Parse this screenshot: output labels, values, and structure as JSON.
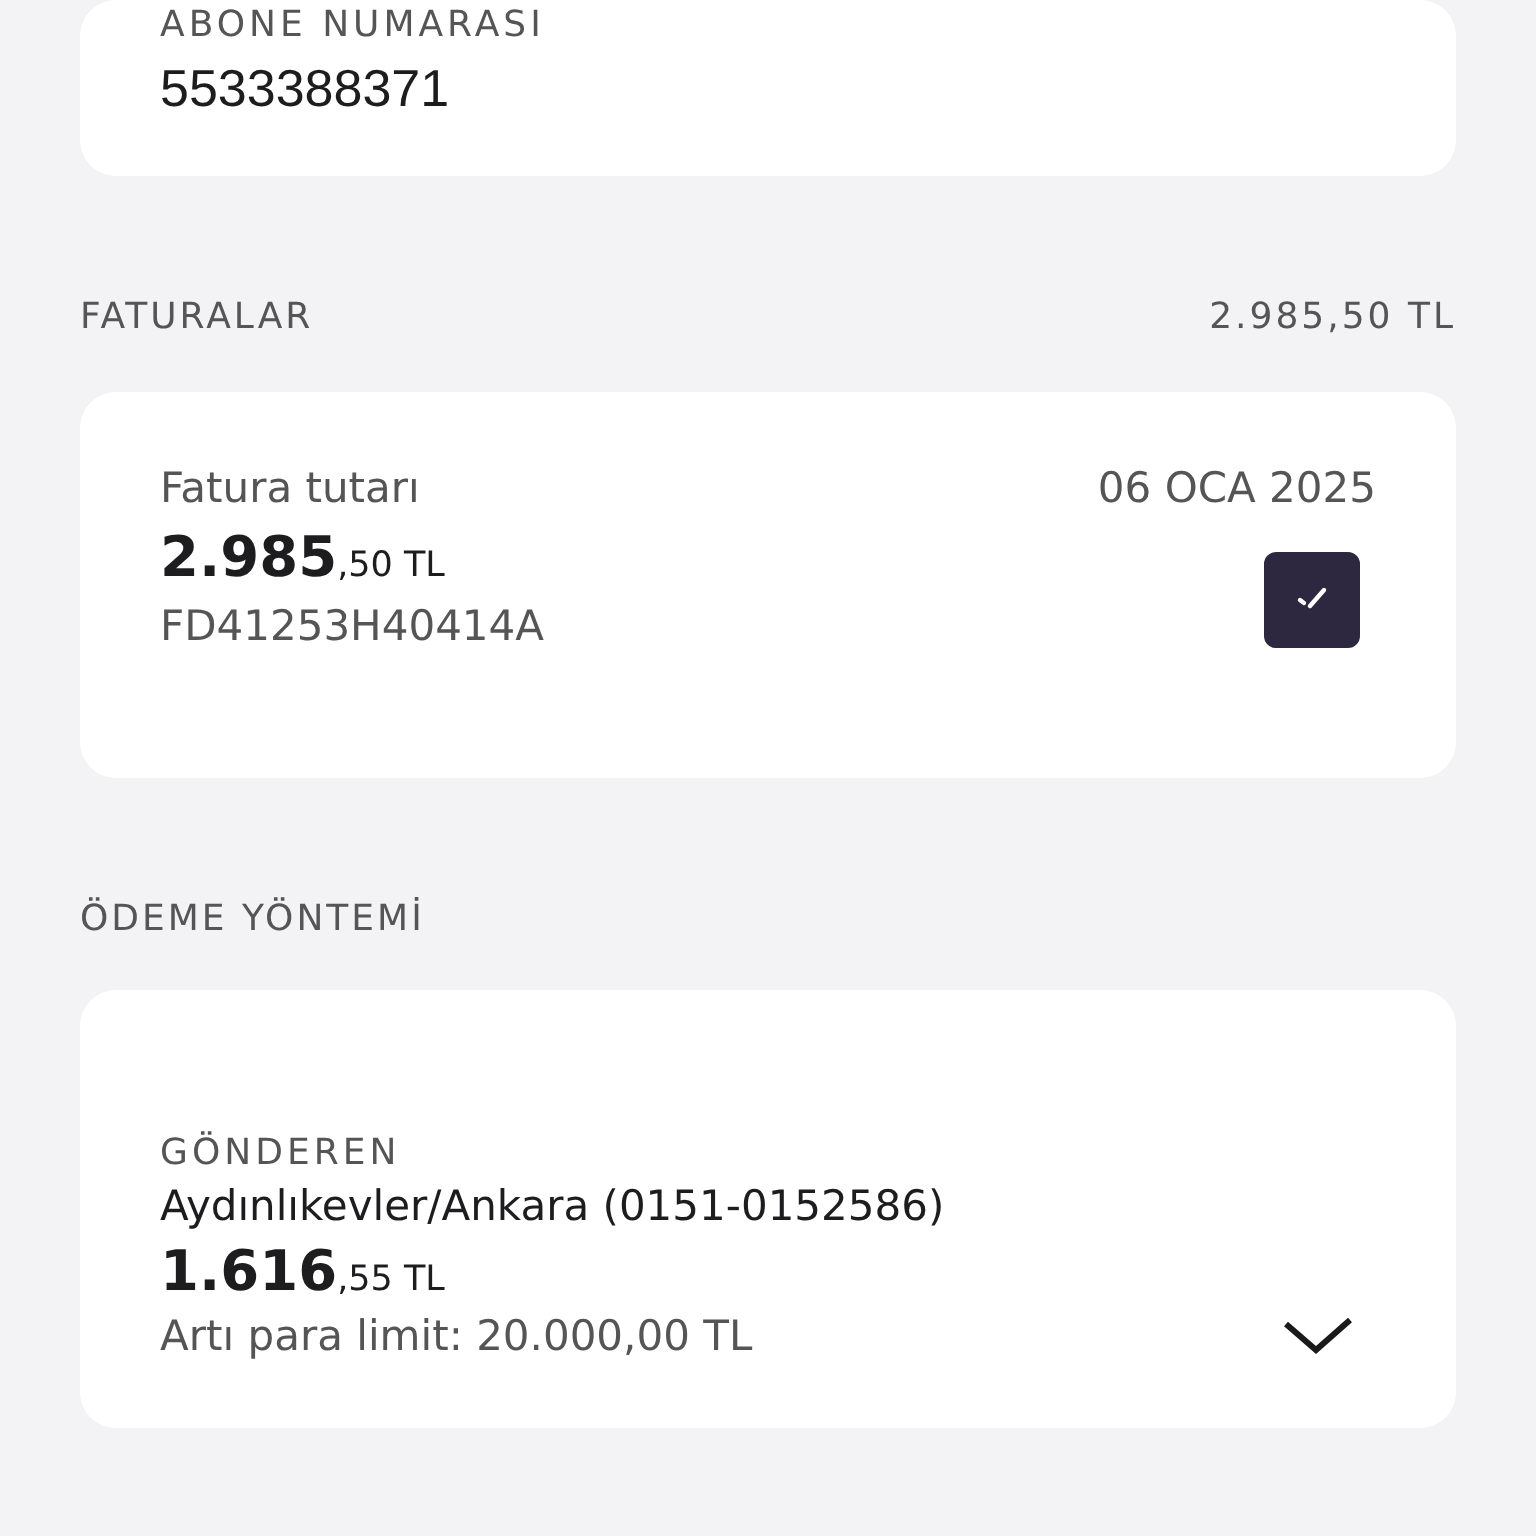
{
  "subscriber": {
    "label": "ABONE NUMARASI",
    "number": "5533388371"
  },
  "invoices": {
    "title": "FATURALAR",
    "total": "2.985,50 TL",
    "items": [
      {
        "label": "Fatura tutarı",
        "date": "06 OCA 2025",
        "amount_major": "2.985",
        "amount_minor": ",50 TL",
        "code": "FD41253H40414A",
        "checked": true
      }
    ]
  },
  "payment": {
    "title": "ÖDEME YÖNTEMİ",
    "label": "GÖNDEREN",
    "account": "Aydınlıkevler/Ankara (0151-0152586)",
    "amount_major": "1.616",
    "amount_minor": ",55 TL",
    "limit": "Artı para limit: 20.000,00 TL"
  }
}
